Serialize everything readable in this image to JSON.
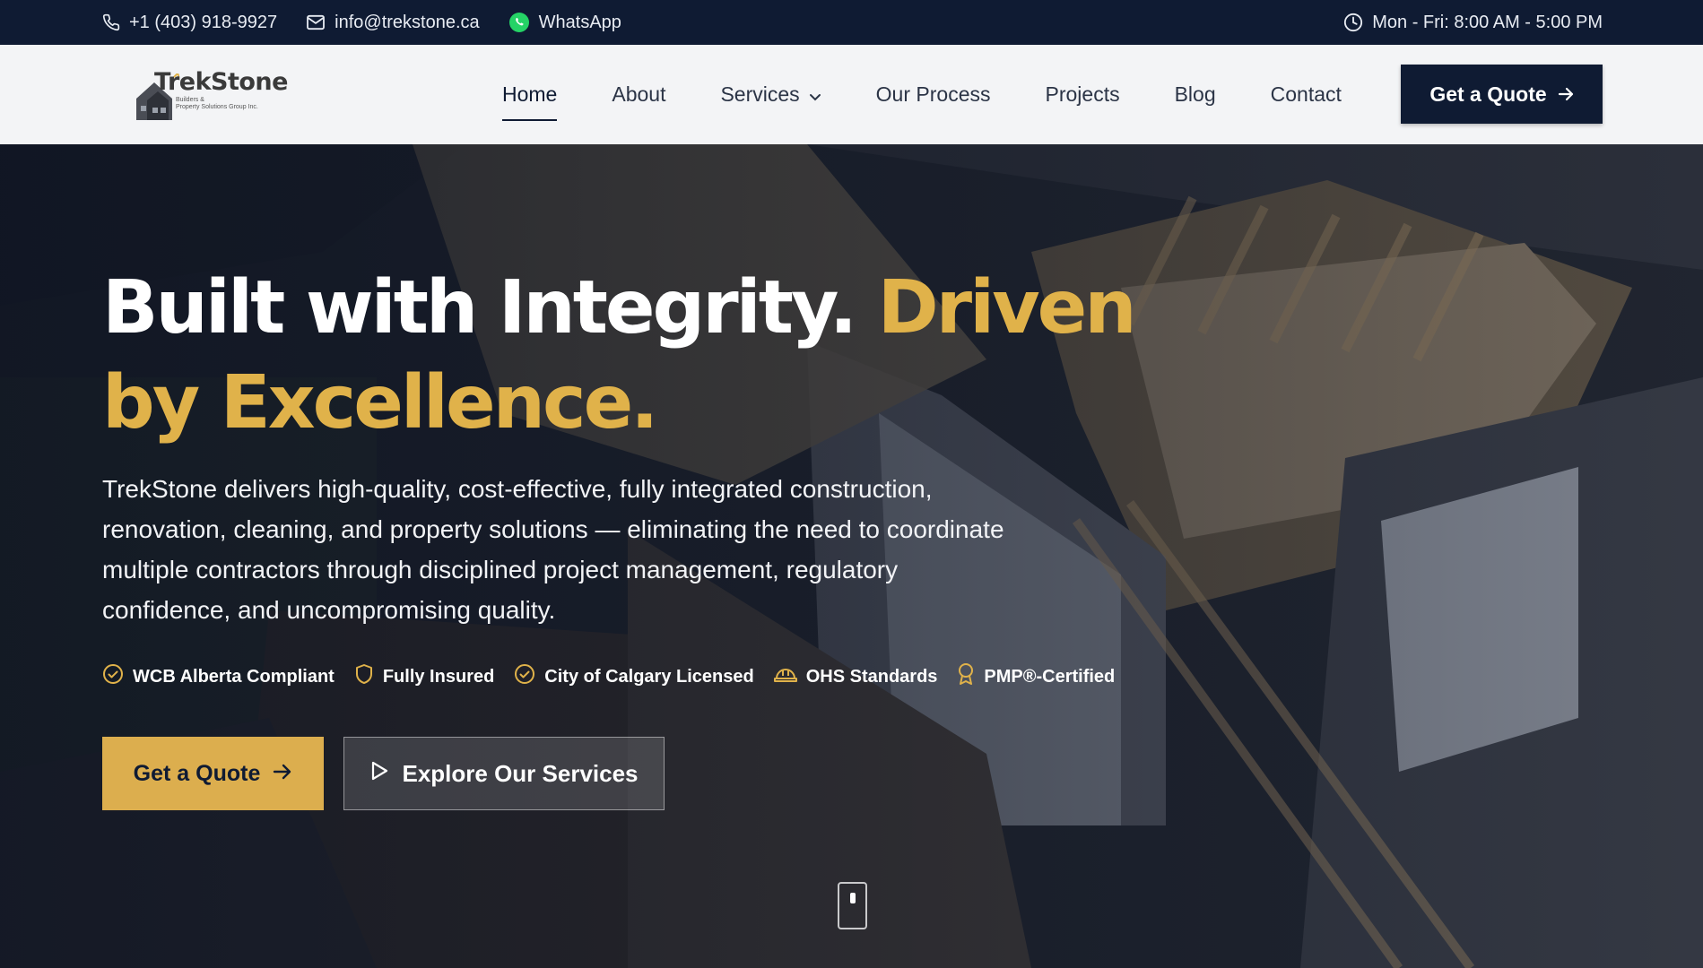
{
  "topbar": {
    "phone": "+1 (403) 918-9927",
    "email": "info@trekstone.ca",
    "whatsapp": "WhatsApp",
    "hours": "Mon - Fri: 8:00 AM - 5:00 PM",
    "icons": [
      "phone-icon",
      "mail-icon",
      "whatsapp-icon",
      "clock-icon"
    ]
  },
  "logo": {
    "name": "TrekStone",
    "tagline_line1": "Builders &",
    "tagline_line2": "Property Solutions Group Inc."
  },
  "nav": {
    "items": [
      {
        "label": "Home",
        "active": true
      },
      {
        "label": "About"
      },
      {
        "label": "Services",
        "dropdown": true
      },
      {
        "label": "Our Process"
      },
      {
        "label": "Projects"
      },
      {
        "label": "Blog"
      },
      {
        "label": "Contact"
      }
    ],
    "cta": "Get a Quote"
  },
  "hero": {
    "headline_white": "Built with Integrity.",
    "headline_gold": "Driven by Excellence.",
    "lead": "TrekStone delivers high-quality, cost-effective, fully integrated construction, renovation, cleaning, and property solutions — eliminating the need to coordinate multiple contractors through disciplined project management, regulatory confidence, and uncompromising quality.",
    "badges": [
      {
        "label": "WCB Alberta Compliant",
        "icon": "check-circle-icon"
      },
      {
        "label": "Fully Insured",
        "icon": "shield-icon"
      },
      {
        "label": "City of Calgary Licensed",
        "icon": "check-circle-icon"
      },
      {
        "label": "OHS Standards",
        "icon": "hard-hat-icon"
      },
      {
        "label": "PMP®-Certified",
        "icon": "award-icon"
      }
    ],
    "primary_cta": "Get a Quote",
    "secondary_cta": "Explore Our Services"
  },
  "colors": {
    "navy": "#0f1b33",
    "gold": "#e0b24a",
    "nav_bg": "#f3f4f6"
  }
}
